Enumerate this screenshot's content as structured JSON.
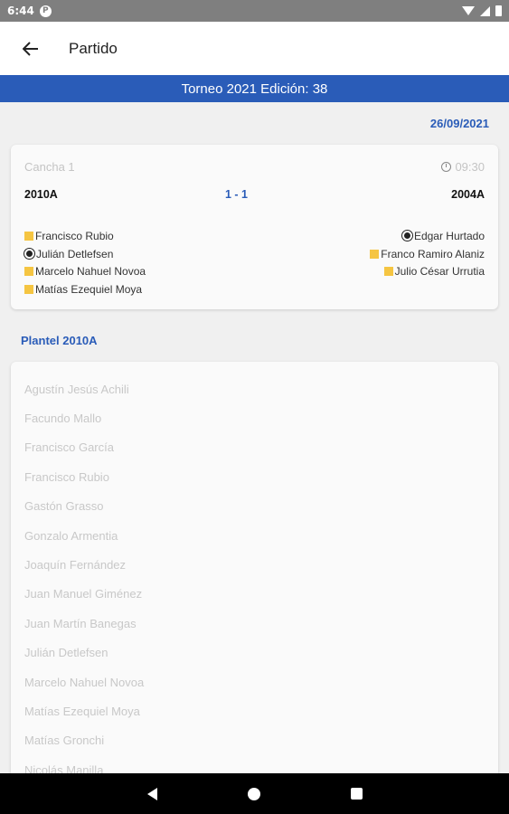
{
  "status_bar": {
    "time": "6:44",
    "notification_icon": "P"
  },
  "app_bar": {
    "title": "Partido"
  },
  "banner": {
    "text": "Torneo 2021 Edición: 38"
  },
  "date": "26/09/2021",
  "match": {
    "court": "Cancha 1",
    "hour": "09:30",
    "home_team": "2010A",
    "away_team": "2004A",
    "score": "1 - 1",
    "home_events": [
      {
        "type": "yellow-card",
        "player": "Francisco Rubio"
      },
      {
        "type": "goal",
        "player": "Julián Detlefsen"
      },
      {
        "type": "yellow-card",
        "player": "Marcelo Nahuel Novoa"
      },
      {
        "type": "yellow-card",
        "player": "Matías Ezequiel Moya"
      }
    ],
    "away_events": [
      {
        "type": "goal",
        "player": "Edgar Hurtado"
      },
      {
        "type": "yellow-card",
        "player": "Franco Ramiro Alaniz"
      },
      {
        "type": "yellow-card",
        "player": "Julio César Urrutia"
      }
    ]
  },
  "squad": {
    "title": "Plantel 2010A",
    "players": [
      "Agustín Jesús Achili",
      "Facundo Mallo",
      "Francisco García",
      "Francisco Rubio",
      "Gastón Grasso",
      "Gonzalo Armentia",
      "Joaquín Fernández",
      "Juan Manuel Giménez",
      "Juan Martín Banegas",
      "Julián Detlefsen",
      "Marcelo Nahuel Novoa",
      "Matías Ezequiel Moya",
      "Matías Gronchi",
      "Nicolás Manilla"
    ]
  },
  "colors": {
    "primary": "#2a5cb8",
    "card_yellow": "#f5c542"
  }
}
